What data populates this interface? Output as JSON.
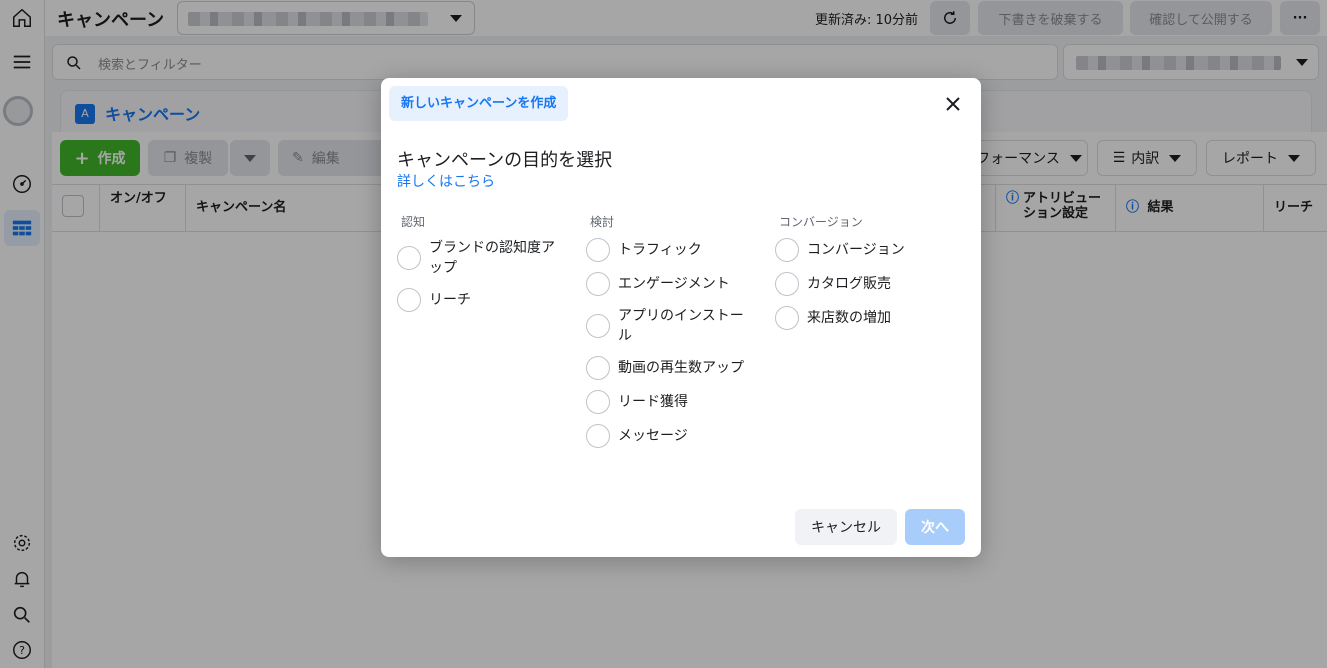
{
  "header": {
    "title": "キャンペーン",
    "updated": "更新済み: 10分前",
    "discard_label": "下書きを破棄する",
    "publish_label": "確認して公開する",
    "more_label": "···"
  },
  "search": {
    "placeholder": "検索とフィルター"
  },
  "tab": {
    "label": "キャンペーン",
    "icon_letter": "A"
  },
  "toolbar": {
    "create_label": "作成",
    "duplicate_label": "複製",
    "edit_label": "編集",
    "performance_label": "フォーマンス",
    "breakdown_label": "内訳",
    "report_label": "レポート"
  },
  "table": {
    "col_onoff": "オン/オフ",
    "col_name": "キャンペーン名",
    "col_attribution": "アトリビューション設定",
    "col_results": "結果",
    "col_reach": "リーチ"
  },
  "modal": {
    "tag": "新しいキャンペーンを作成",
    "heading": "キャンペーンの目的を選択",
    "learn_more": "詳しくはこちら",
    "columns": [
      {
        "title": "認知",
        "options": [
          "ブランドの認知度アップ",
          "リーチ"
        ]
      },
      {
        "title": "検討",
        "options": [
          "トラフィック",
          "エンゲージメント",
          "アプリのインストール",
          "動画の再生数アップ",
          "リード獲得",
          "メッセージ"
        ]
      },
      {
        "title": "コンバージョン",
        "options": [
          "コンバージョン",
          "カタログ販売",
          "来店数の増加"
        ]
      }
    ],
    "cancel_label": "キャンセル",
    "next_label": "次へ"
  },
  "colors": {
    "accent": "#1877f2",
    "create": "#42b72a",
    "next_disabled": "#a9cdfa"
  }
}
